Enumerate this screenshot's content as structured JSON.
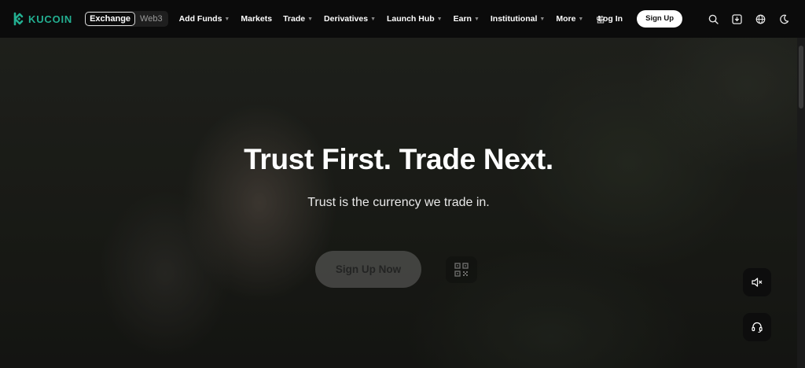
{
  "brand": {
    "name": "KUCOIN",
    "accent_color": "#23af91"
  },
  "mode_switch": {
    "active": "Exchange",
    "inactive": "Web3"
  },
  "nav": {
    "items": [
      {
        "label": "Add Funds",
        "has_dropdown": true
      },
      {
        "label": "Markets",
        "has_dropdown": false
      },
      {
        "label": "Trade",
        "has_dropdown": true
      },
      {
        "label": "Derivatives",
        "has_dropdown": true
      },
      {
        "label": "Launch Hub",
        "has_dropdown": true
      },
      {
        "label": "Earn",
        "has_dropdown": true
      },
      {
        "label": "Institutional",
        "has_dropdown": true
      },
      {
        "label": "More",
        "has_dropdown": true
      }
    ],
    "gift_icon": "gift-icon"
  },
  "header_right": {
    "login_label": "Log In",
    "signup_label": "Sign Up",
    "icons": [
      "search-icon",
      "download-icon",
      "globe-icon",
      "moon-icon"
    ]
  },
  "hero": {
    "title": "Trust First. Trade Next.",
    "subtitle": "Trust is the currency we trade in.",
    "cta_label": "Sign Up Now",
    "qr_icon": "qr-code-icon"
  },
  "floating": {
    "mute_icon": "speaker-mute-icon",
    "support_icon": "headset-icon"
  }
}
